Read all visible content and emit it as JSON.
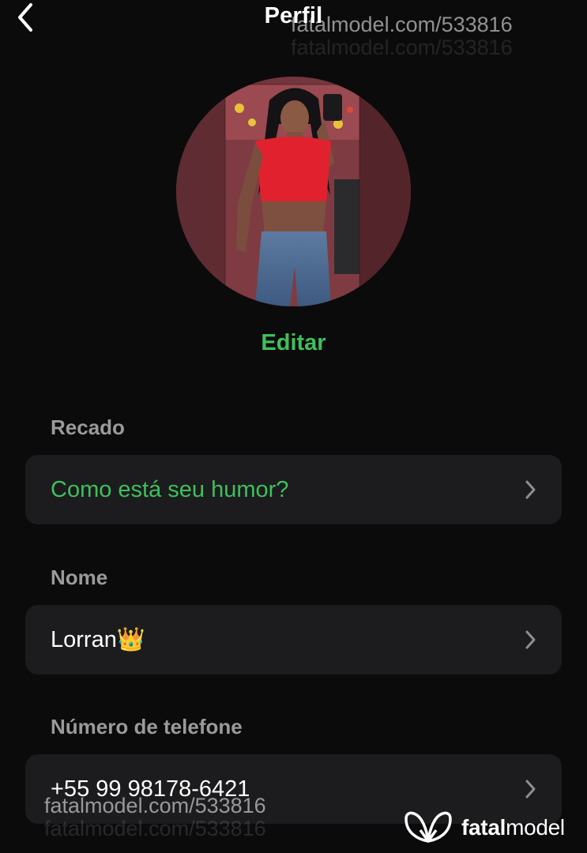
{
  "header": {
    "title": "Perfil",
    "back_icon": "chevron-left-icon"
  },
  "watermark": {
    "line1": "fatalmodel.com/533816",
    "line2": "fatalmodel.com/533816"
  },
  "avatar": {
    "alt": "profile photo"
  },
  "edit_label": "Editar",
  "sections": [
    {
      "label": "Recado",
      "value": "Como está seu humor?",
      "value_color": "#3fbf5c"
    },
    {
      "label": "Nome",
      "value": "Lorran👑",
      "value_color": "#ffffff"
    },
    {
      "label": "Número de telefone",
      "value": "+55 99 98178-6421",
      "value_color": "#ffffff"
    }
  ],
  "brand": {
    "name_bold": "fatal",
    "name_light": "model",
    "logo_icon": "butterfly-logo-icon"
  },
  "colors": {
    "background": "#0b0b0b",
    "row_background": "#1c1c1e",
    "accent": "#3fbf5c",
    "label": "#9a9a9a"
  }
}
